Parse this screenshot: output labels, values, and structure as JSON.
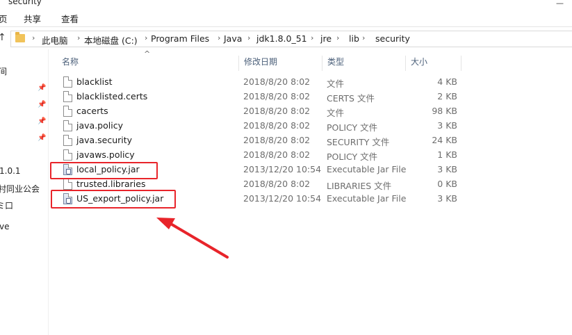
{
  "window": {
    "title": "security",
    "control_glyph": "—"
  },
  "ribbon": {
    "tabs": [
      "页",
      "共享",
      "查看"
    ]
  },
  "address": {
    "up_glyph": "↑",
    "crumbs": [
      "此电脑",
      "本地磁盘 (C:)",
      "Program Files",
      "Java",
      "jdk1.8.0_51",
      "jre",
      "lib",
      "security"
    ],
    "separator": "›"
  },
  "navpane": {
    "items": [
      "间",
      "1.0.1",
      "村同业公会",
      "ミ口",
      "ve"
    ],
    "pin_glyph": "📌"
  },
  "columns": {
    "name": "名称",
    "modified": "修改日期",
    "type": "类型",
    "size": "大小",
    "sort_glyph": "^"
  },
  "files": [
    {
      "name": "blacklist",
      "modified": "2018/8/20 8:02",
      "type": "文件",
      "size": "4 KB",
      "icon": "document-icon"
    },
    {
      "name": "blacklisted.certs",
      "modified": "2018/8/20 8:02",
      "type": "CERTS 文件",
      "size": "2 KB",
      "icon": "document-icon"
    },
    {
      "name": "cacerts",
      "modified": "2018/8/20 8:02",
      "type": "文件",
      "size": "98 KB",
      "icon": "document-icon"
    },
    {
      "name": "java.policy",
      "modified": "2018/8/20 8:02",
      "type": "POLICY 文件",
      "size": "3 KB",
      "icon": "document-icon"
    },
    {
      "name": "java.security",
      "modified": "2018/8/20 8:02",
      "type": "SECURITY 文件",
      "size": "24 KB",
      "icon": "document-icon"
    },
    {
      "name": "javaws.policy",
      "modified": "2018/8/20 8:02",
      "type": "POLICY 文件",
      "size": "1 KB",
      "icon": "document-icon"
    },
    {
      "name": "local_policy.jar",
      "modified": "2013/12/20 10:54",
      "type": "Executable Jar File",
      "size": "3 KB",
      "icon": "jar-file-icon"
    },
    {
      "name": "trusted.libraries",
      "modified": "2018/8/20 8:02",
      "type": "LIBRARIES 文件",
      "size": "0 KB",
      "icon": "document-icon"
    },
    {
      "name": "US_export_policy.jar",
      "modified": "2013/12/20 10:54",
      "type": "Executable Jar File",
      "size": "3 KB",
      "icon": "jar-file-icon"
    }
  ],
  "annotation": {
    "color": "#e8242a"
  }
}
